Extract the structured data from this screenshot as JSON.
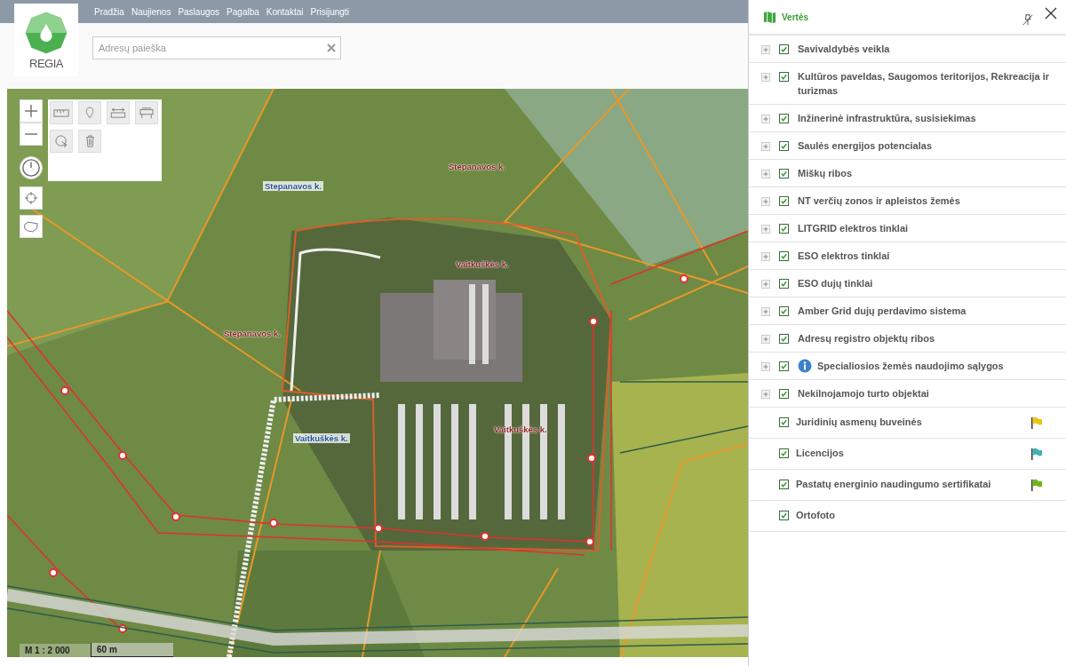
{
  "nav": [
    "Pradžia",
    "Naujienos",
    "Paslaugos",
    "Pagalba",
    "Kontaktai",
    "Prisijungti"
  ],
  "logo": {
    "text": "REGIA"
  },
  "search": {
    "placeholder": "Adresų paieška"
  },
  "map": {
    "labels": [
      {
        "text": "Stepanavos k.",
        "kind": "red"
      },
      {
        "text": "Stepanavos k.",
        "kind": "blue"
      },
      {
        "text": "Stepanavos k.",
        "kind": "red"
      },
      {
        "text": "Vaitkuškės k.",
        "kind": "red"
      },
      {
        "text": "Vaitkuškės k.",
        "kind": "blue"
      },
      {
        "text": "Vaitkuškės k.",
        "kind": "red"
      }
    ],
    "scale": "M 1 : 2 000",
    "distance": "60 m"
  },
  "panel": {
    "title": "Vertės",
    "layers": [
      {
        "label": "Savivaldybės veikla",
        "kind": "group",
        "checked": true,
        "info": false
      },
      {
        "label": "Kultūros paveldas, Saugomos teritorijos, Rekreacija ir turizmas",
        "kind": "group",
        "checked": true,
        "info": false
      },
      {
        "label": "Inžinerinė infrastruktūra, susisiekimas",
        "kind": "group",
        "checked": true,
        "info": false
      },
      {
        "label": "Saulės energijos potencialas",
        "kind": "group",
        "checked": true,
        "info": false
      },
      {
        "label": "Miškų ribos",
        "kind": "group",
        "checked": true,
        "info": false
      },
      {
        "label": "NT verčių zonos ir apleistos žemės",
        "kind": "group",
        "checked": true,
        "info": false
      },
      {
        "label": "LITGRID elektros tinklai",
        "kind": "group",
        "checked": true,
        "info": false
      },
      {
        "label": "ESO elektros tinklai",
        "kind": "group",
        "checked": true,
        "info": false
      },
      {
        "label": "ESO dujų tinklai",
        "kind": "group",
        "checked": true,
        "info": false
      },
      {
        "label": "Amber Grid dujų perdavimo sistema",
        "kind": "group",
        "checked": true,
        "info": false
      },
      {
        "label": "Adresų registro objektų ribos",
        "kind": "group",
        "checked": true,
        "info": false
      },
      {
        "label": "Specialiosios žemės naudojimo sąlygos",
        "kind": "group",
        "checked": true,
        "info": true
      },
      {
        "label": "Nekilnojamojo turto objektai",
        "kind": "group",
        "checked": true,
        "info": false
      },
      {
        "label": "Juridinių asmenų buveinės",
        "kind": "layer",
        "checked": true,
        "info": false,
        "color": "#e8c619"
      },
      {
        "label": "Licencijos",
        "kind": "layer",
        "checked": true,
        "info": false,
        "color": "#3fb3b0"
      },
      {
        "label": "Pastatų energinio naudingumo sertifikatai",
        "kind": "layer",
        "checked": true,
        "info": false,
        "color": "#6fb51c"
      },
      {
        "label": "Ortofoto",
        "kind": "layer",
        "checked": true,
        "info": false
      }
    ]
  }
}
